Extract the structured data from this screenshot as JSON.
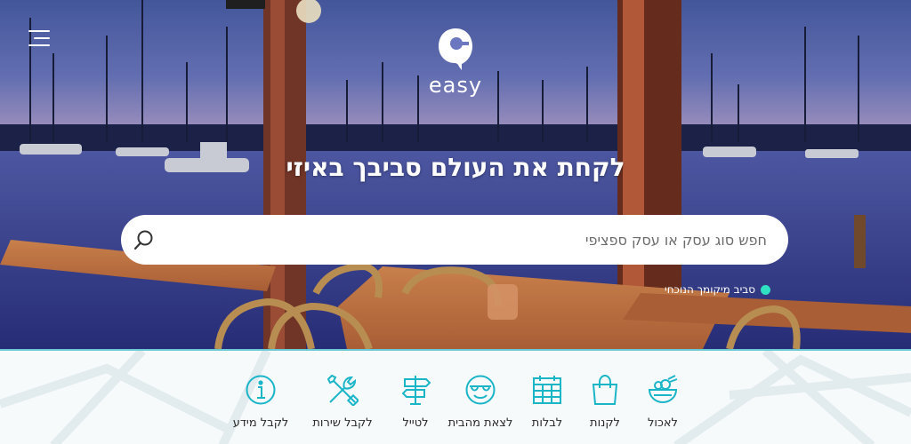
{
  "header": {
    "menu_icon": "hamburger-menu-icon",
    "logo_text": "easy",
    "logo_icon": "easy-logo-icon"
  },
  "hero": {
    "tagline": "לקחת את העולם סביבך באיזי",
    "search": {
      "placeholder": "חפש סוג עסק או עסק ספציפי",
      "value": "",
      "icon": "search-icon"
    },
    "location_label": "סביב מיקומך הנוכחי",
    "location_dot_color": "#2fe0c2"
  },
  "categories": [
    {
      "label": "לאכול",
      "icon": "food-bowl-icon"
    },
    {
      "label": "לקנות",
      "icon": "shopping-bag-icon"
    },
    {
      "label": "לבלות",
      "icon": "calendar-icon"
    },
    {
      "label": "לצאת מהבית",
      "icon": "smiley-sunglasses-icon"
    },
    {
      "label": "לטייל",
      "icon": "signpost-icon"
    },
    {
      "label": "לקבל שירות",
      "icon": "tools-icon"
    },
    {
      "label": "לקבל מידע",
      "icon": "info-icon"
    }
  ],
  "colors": {
    "accent": "#1bb5c8",
    "strip_border": "#6cc7d4",
    "icon_color": "#1bb5c8"
  }
}
